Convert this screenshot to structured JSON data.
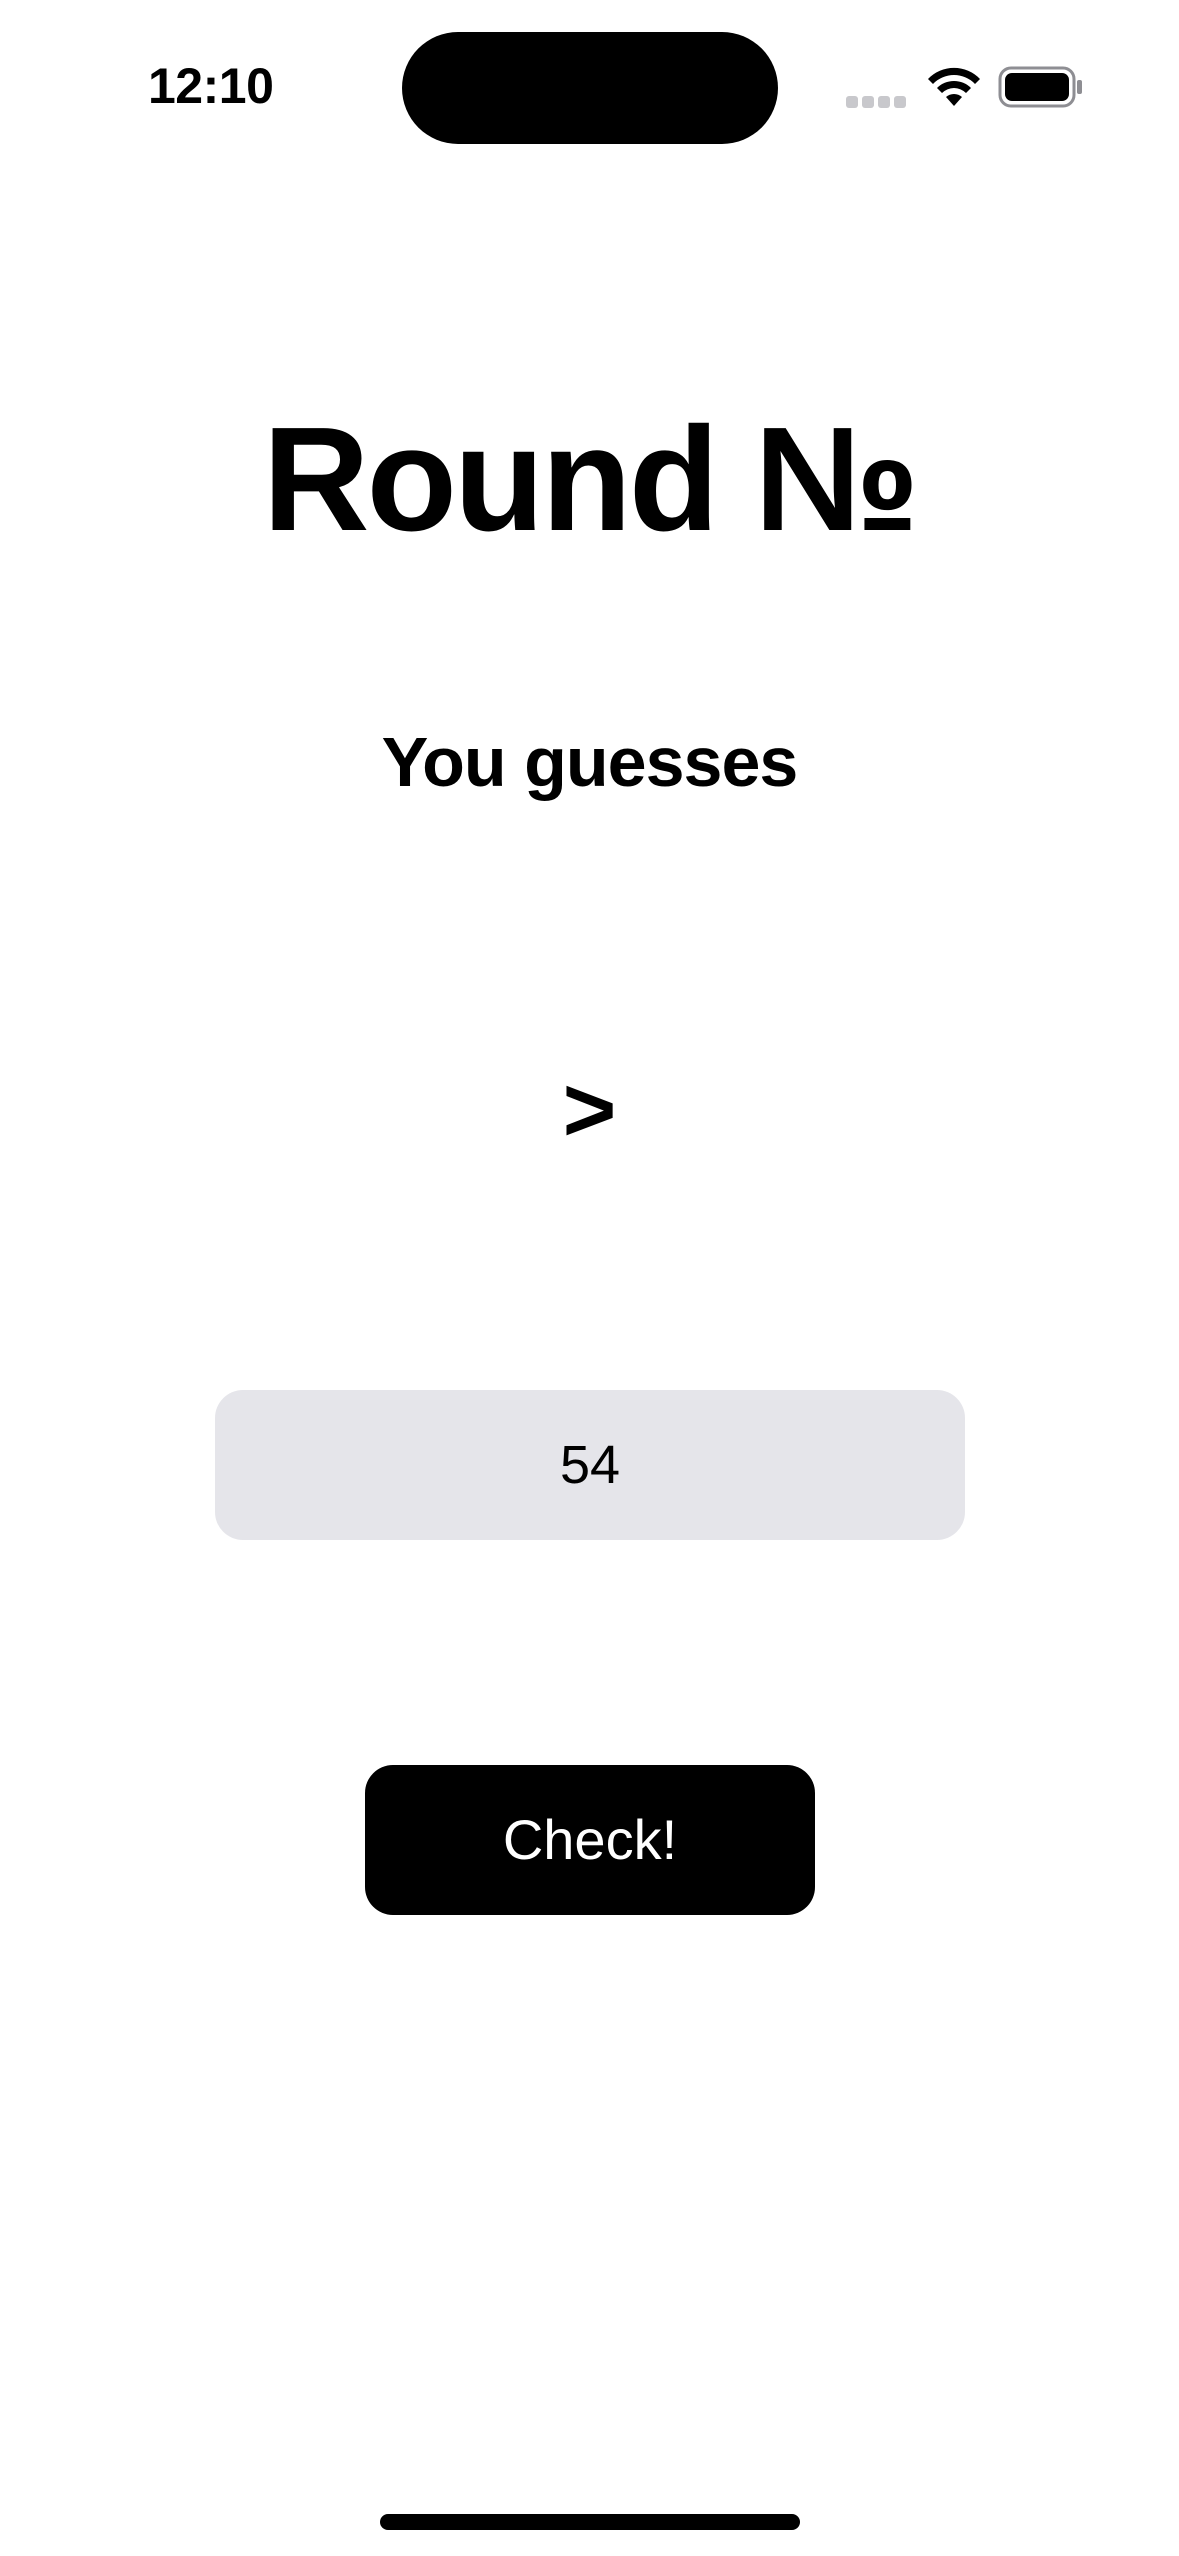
{
  "status_bar": {
    "time": "12:10",
    "icons": [
      "cellular-signal-icon",
      "wifi-icon",
      "battery-icon"
    ]
  },
  "game": {
    "round_title": "Round №",
    "subtitle": "You guesses",
    "hint_symbol": ">"
  },
  "guess_input": {
    "value": "54"
  },
  "actions": {
    "check_label": "Check!"
  },
  "colors": {
    "background": "#ffffff",
    "text": "#000000",
    "input_background": "#e5e5ea",
    "button_background": "#000000",
    "button_text": "#ffffff"
  }
}
